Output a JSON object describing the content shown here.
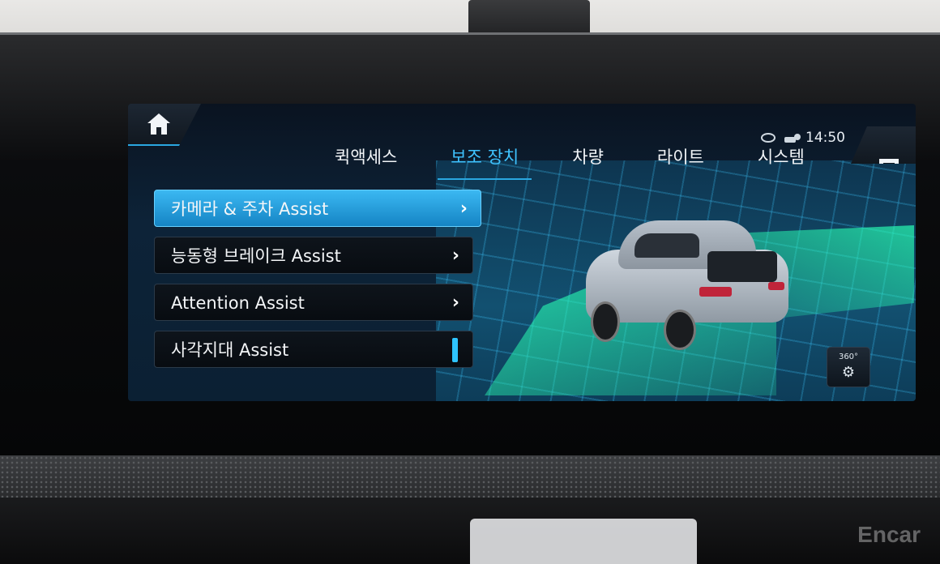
{
  "environment": {
    "watermark": "Encar"
  },
  "screen": {
    "status": {
      "clock": "14:50",
      "icons": [
        "connectivity-icon",
        "navigation-icon"
      ]
    },
    "tabs": [
      {
        "label": "퀵액세스",
        "active": false
      },
      {
        "label": "보조 장치",
        "active": true
      },
      {
        "label": "차량",
        "active": false
      },
      {
        "label": "라이트",
        "active": false
      },
      {
        "label": "시스템",
        "active": false
      }
    ],
    "menu": [
      {
        "label": "카메라 & 주차 Assist",
        "selected": true,
        "control": "chevron"
      },
      {
        "label": "능동형 브레이크 Assist",
        "selected": false,
        "control": "chevron"
      },
      {
        "label": "Attention Assist",
        "selected": false,
        "control": "chevron"
      },
      {
        "label": "사각지대 Assist",
        "selected": false,
        "control": "toggle"
      }
    ],
    "camera_button_label": "360°",
    "colors": {
      "accent": "#2aa7e0",
      "selected_item": "#1f96d6"
    }
  }
}
